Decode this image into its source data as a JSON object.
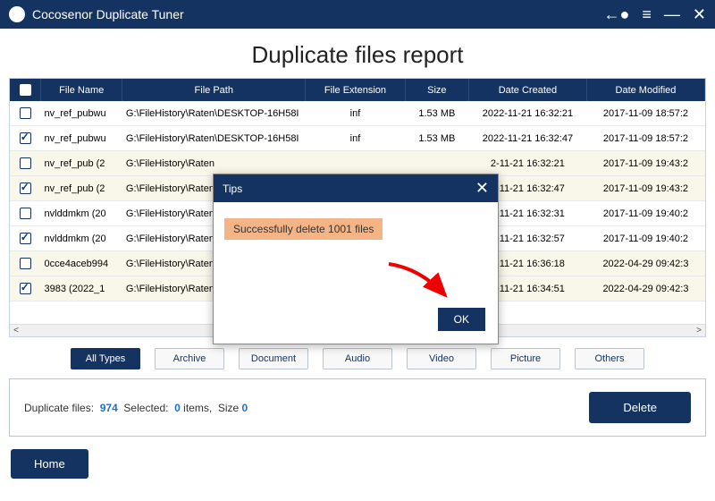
{
  "titlebar": {
    "app_name": "Cocosenor Duplicate Tuner"
  },
  "heading": "Duplicate files report",
  "columns": {
    "chk": "",
    "name": "File Name",
    "path": "File Path",
    "ext": "File Extension",
    "size": "Size",
    "created": "Date Created",
    "modified": "Date Modified"
  },
  "rows": [
    {
      "checked": false,
      "name": "nv_ref_pubwu",
      "path": "G:\\FileHistory\\Raten\\DESKTOP-16H58I",
      "ext": "inf",
      "size": "1.53 MB",
      "created": "2022-11-21 16:32:21",
      "modified": "2017-11-09 18:57:2",
      "alt": false
    },
    {
      "checked": true,
      "name": "nv_ref_pubwu",
      "path": "G:\\FileHistory\\Raten\\DESKTOP-16H58I",
      "ext": "inf",
      "size": "1.53 MB",
      "created": "2022-11-21 16:32:47",
      "modified": "2017-11-09 18:57:2",
      "alt": false
    },
    {
      "checked": false,
      "name": "nv_ref_pub (2",
      "path": "G:\\FileHistory\\Raten",
      "ext": "",
      "size": "",
      "created": "2-11-21 16:32:21",
      "modified": "2017-11-09 19:43:2",
      "alt": true
    },
    {
      "checked": true,
      "name": "nv_ref_pub (2",
      "path": "G:\\FileHistory\\Raten",
      "ext": "",
      "size": "",
      "created": "2-11-21 16:32:47",
      "modified": "2017-11-09 19:43:2",
      "alt": true
    },
    {
      "checked": false,
      "name": "nvlddmkm (20",
      "path": "G:\\FileHistory\\Raten",
      "ext": "",
      "size": "",
      "created": "2-11-21 16:32:31",
      "modified": "2017-11-09 19:40:2",
      "alt": false
    },
    {
      "checked": true,
      "name": "nvlddmkm (20",
      "path": "G:\\FileHistory\\Raten",
      "ext": "",
      "size": "",
      "created": "2-11-21 16:32:57",
      "modified": "2017-11-09 19:40:2",
      "alt": false
    },
    {
      "checked": false,
      "name": "0cce4aceb994",
      "path": "G:\\FileHistory\\Raten",
      "ext": "",
      "size": "",
      "created": "2-11-21 16:36:18",
      "modified": "2022-04-29 09:42:3",
      "alt": true
    },
    {
      "checked": true,
      "name": "3983 (2022_1",
      "path": "G:\\FileHistory\\Raten",
      "ext": "",
      "size": "",
      "created": "2-11-21 16:34:51",
      "modified": "2022-04-29 09:42:3",
      "alt": true
    }
  ],
  "filters": [
    {
      "label": "All Types",
      "active": true
    },
    {
      "label": "Archive",
      "active": false
    },
    {
      "label": "Document",
      "active": false
    },
    {
      "label": "Audio",
      "active": false
    },
    {
      "label": "Video",
      "active": false
    },
    {
      "label": "Picture",
      "active": false
    },
    {
      "label": "Others",
      "active": false
    }
  ],
  "status": {
    "dup_label": "Duplicate files:",
    "dup_count": "974",
    "sel_label": "Selected:",
    "sel_items": "0",
    "items_word": "items,",
    "size_word": "Size",
    "size_val": "0",
    "delete_label": "Delete"
  },
  "home_label": "Home",
  "modal": {
    "title": "Tips",
    "message": "Successfully delete 1001 files",
    "ok": "OK"
  }
}
